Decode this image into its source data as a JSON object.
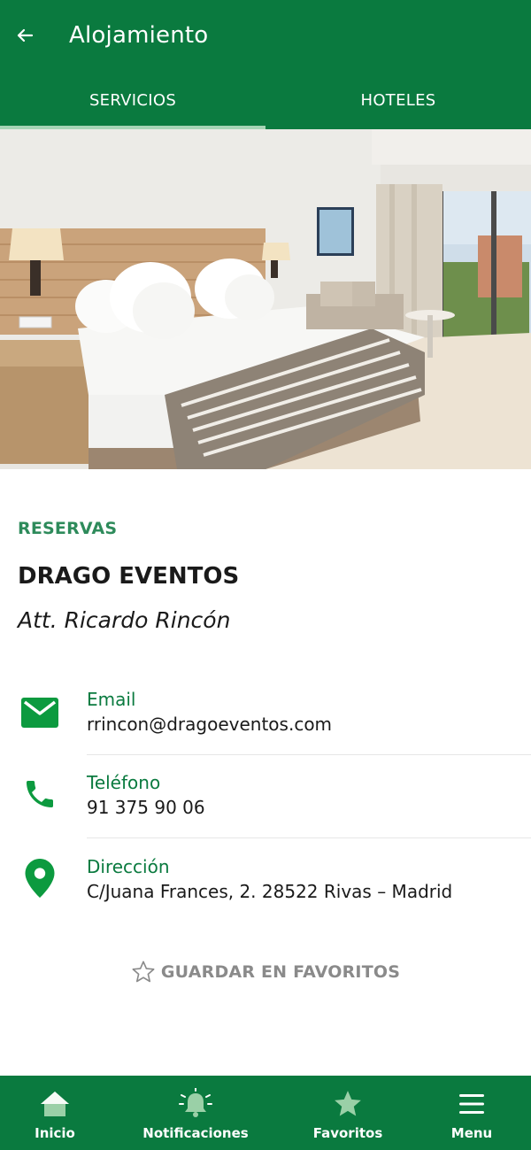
{
  "header": {
    "title": "Alojamiento",
    "back_icon": "arrow-back-icon"
  },
  "tabs": [
    {
      "label": "SERVICIOS",
      "active": true
    },
    {
      "label": "HOTELES",
      "active": false
    }
  ],
  "colors": {
    "primary": "#0a7a3f",
    "accent_label": "#2e8b5b",
    "icon_green": "#0c9a3f",
    "tab_indicator": "#a6d4b5"
  },
  "content": {
    "section_label": "RESERVAS",
    "company": "DRAGO EVENTOS",
    "contact_person": "Att. Ricardo Rincón"
  },
  "contacts": [
    {
      "icon": "email-icon",
      "label": "Email",
      "value": "rrincon@dragoeventos.com"
    },
    {
      "icon": "phone-icon",
      "label": "Teléfono",
      "value": "91 375 90 06"
    },
    {
      "icon": "location-pin-icon",
      "label": "Dirección",
      "value": "C/Juana Frances, 2. 28522 Rivas – Madrid"
    }
  ],
  "favorite": {
    "icon": "star-outline-icon",
    "label": "GUARDAR EN FAVORITOS"
  },
  "bottom_nav": [
    {
      "icon": "home-icon",
      "label": "Inicio"
    },
    {
      "icon": "bell-icon",
      "label": "Notificaciones"
    },
    {
      "icon": "star-icon",
      "label": "Favoritos"
    },
    {
      "icon": "menu-icon",
      "label": "Menu"
    }
  ]
}
